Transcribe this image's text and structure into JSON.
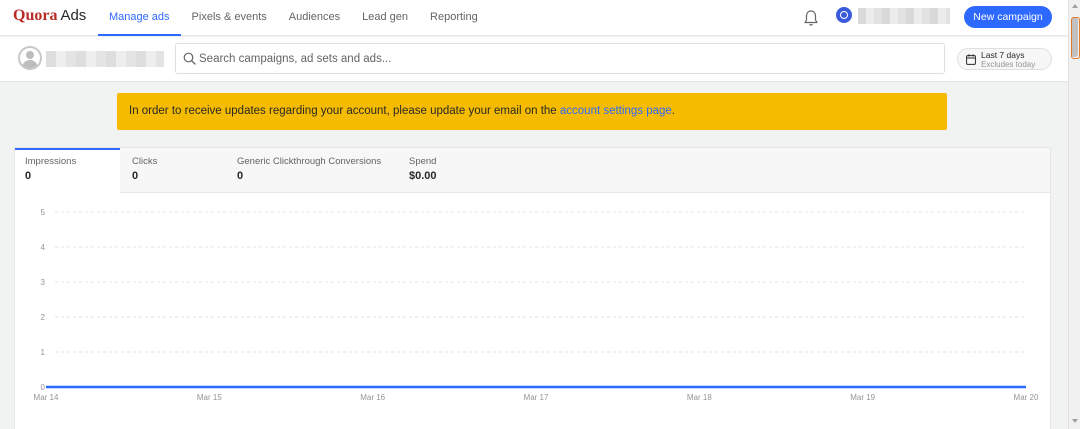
{
  "brand": {
    "name": "Quora",
    "product": "Ads"
  },
  "nav": {
    "items": [
      {
        "label": "Manage ads",
        "active": true
      },
      {
        "label": "Pixels & events",
        "active": false
      },
      {
        "label": "Audiences",
        "active": false
      },
      {
        "label": "Lead gen",
        "active": false
      },
      {
        "label": "Reporting",
        "active": false
      }
    ]
  },
  "header": {
    "new_campaign_label": "New campaign"
  },
  "search": {
    "placeholder": "Search campaigns, ad sets and ads..."
  },
  "date_range": {
    "label": "Last 7 days",
    "sublabel": "Excludes today"
  },
  "banner": {
    "text": "In order to receive updates regarding your account, please update your email on the ",
    "link_text": "account settings page",
    "suffix": "."
  },
  "metrics": {
    "tabs": [
      {
        "label": "Impressions",
        "value": "0",
        "active": true
      },
      {
        "label": "Clicks",
        "value": "0",
        "active": false
      },
      {
        "label": "Generic Clickthrough Conversions",
        "value": "0",
        "active": false
      },
      {
        "label": "Spend",
        "value": "$0.00",
        "active": false
      }
    ]
  },
  "chart_data": {
    "type": "line",
    "x": [
      "Mar 14",
      "Mar 15",
      "Mar 16",
      "Mar 17",
      "Mar 18",
      "Mar 19",
      "Mar 20"
    ],
    "series": [
      {
        "values": [
          0,
          0,
          0,
          0,
          0,
          0,
          0
        ]
      }
    ],
    "yticks": [
      0,
      1,
      2,
      3,
      4,
      5
    ],
    "ylim": [
      0,
      5
    ],
    "grid": true,
    "line_color": "#2e69ff",
    "title": "",
    "xlabel": "",
    "ylabel": ""
  },
  "colors": {
    "accent": "#2e69ff",
    "brand": "#b92b27",
    "banner": "#f5bb00"
  }
}
